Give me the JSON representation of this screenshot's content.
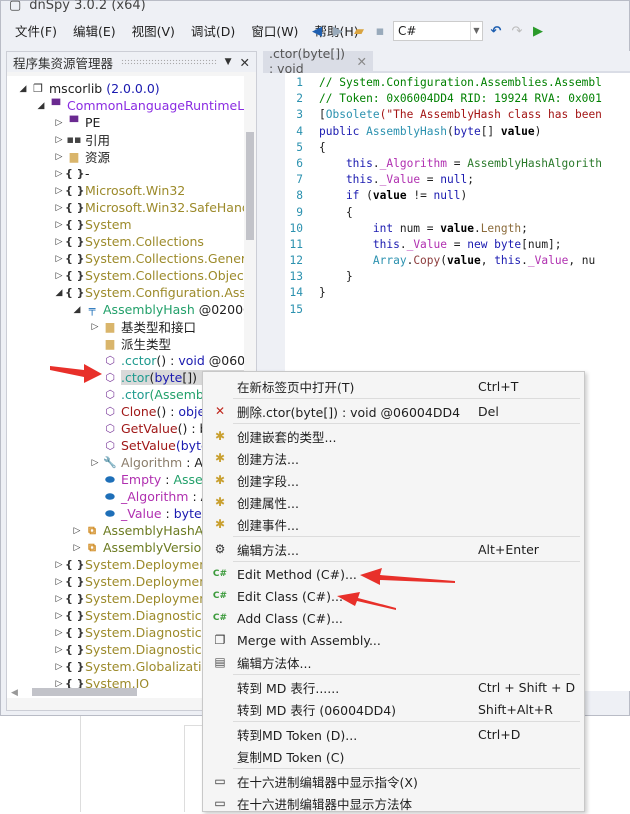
{
  "window": {
    "title": "dnSpy 3.0.2 (x64)"
  },
  "menubar": [
    "文件(F)",
    "编辑(E)",
    "视图(V)",
    "调试(D)",
    "窗口(W)",
    "帮助(H)"
  ],
  "toolbar": {
    "language": "C#",
    "icons": [
      "back-icon",
      "forward-icon",
      "open-icon",
      "save-icon",
      "undo-icon",
      "redo-icon",
      "start-icon"
    ]
  },
  "assembly_explorer": {
    "title": "程序集资源管理器",
    "items": [
      {
        "l": 0,
        "e": "open",
        "i": "assembly-icon",
        "s": [
          [
            "mscorlib ",
            "#1e1e1e"
          ],
          [
            "(2.0.0.0)",
            "#1a1ab0"
          ]
        ]
      },
      {
        "l": 1,
        "e": "open",
        "i": "module-icon",
        "s": [
          [
            "CommonLanguageRuntimeLib",
            "#8a2be2"
          ]
        ]
      },
      {
        "l": 2,
        "e": "closed",
        "i": "pe-icon",
        "s": [
          [
            "PE",
            "#1e1e1e"
          ]
        ]
      },
      {
        "l": 2,
        "e": "closed",
        "i": "references-icon",
        "s": [
          [
            "引用",
            "#1e1e1e"
          ]
        ]
      },
      {
        "l": 2,
        "e": "closed",
        "i": "folder-icon",
        "s": [
          [
            "资源",
            "#1e1e1e"
          ]
        ]
      },
      {
        "l": 2,
        "e": "closed",
        "i": "namespace-icon",
        "s": [
          [
            "-",
            "#1e1e1e"
          ]
        ]
      },
      {
        "l": 2,
        "e": "closed",
        "i": "namespace-icon",
        "s": [
          [
            "Microsoft.Win32",
            "#9c8a2a"
          ]
        ]
      },
      {
        "l": 2,
        "e": "closed",
        "i": "namespace-icon",
        "s": [
          [
            "Microsoft.Win32.SafeHand",
            "#9c8a2a"
          ]
        ]
      },
      {
        "l": 2,
        "e": "closed",
        "i": "namespace-icon",
        "s": [
          [
            "System",
            "#9c8a2a"
          ]
        ]
      },
      {
        "l": 2,
        "e": "closed",
        "i": "namespace-icon",
        "s": [
          [
            "System.Collections",
            "#9c8a2a"
          ]
        ]
      },
      {
        "l": 2,
        "e": "closed",
        "i": "namespace-icon",
        "s": [
          [
            "System.Collections.Generic",
            "#9c8a2a"
          ]
        ]
      },
      {
        "l": 2,
        "e": "closed",
        "i": "namespace-icon",
        "s": [
          [
            "System.Collections.ObjectM",
            "#9c8a2a"
          ]
        ]
      },
      {
        "l": 2,
        "e": "open",
        "i": "namespace-icon",
        "s": [
          [
            "System.Configuration.Asse",
            "#9c8a2a"
          ]
        ]
      },
      {
        "l": 3,
        "e": "open",
        "i": "class-icon",
        "s": [
          [
            "AssemblyHash ",
            "#22a06a"
          ],
          [
            "@02000",
            "#1e1e1e"
          ]
        ]
      },
      {
        "l": 4,
        "e": "closed",
        "i": "folder-icon",
        "s": [
          [
            "基类型和接口",
            "#1e1e1e"
          ]
        ]
      },
      {
        "l": 4,
        "e": "",
        "i": "folder-icon",
        "s": [
          [
            "派生类型",
            "#1e1e1e"
          ]
        ]
      },
      {
        "l": 4,
        "e": "",
        "i": "method-icon",
        "s": [
          [
            ".cctor",
            "#1e9a8e"
          ],
          [
            "() : ",
            "#1e1e1e"
          ],
          [
            "void ",
            "#1a1ab0"
          ],
          [
            "@0600",
            "#1e1e1e"
          ]
        ]
      },
      {
        "l": 4,
        "e": "",
        "i": "method-icon",
        "sel": true,
        "s": [
          [
            ".ctor",
            "#1e9a8e"
          ],
          [
            "(",
            "#1e1e1e"
          ],
          [
            "byte",
            "#1a1ab0"
          ],
          [
            "[]) : ",
            "#1e1e1e"
          ],
          [
            "void @",
            "#1a1ab0"
          ]
        ]
      },
      {
        "l": 4,
        "e": "",
        "i": "method-icon",
        "s": [
          [
            ".ctor",
            "#1e9a8e"
          ],
          [
            "(Assemb",
            "#22a06a"
          ]
        ]
      },
      {
        "l": 4,
        "e": "",
        "i": "method-icon",
        "s": [
          [
            "Clone",
            "#a01818"
          ],
          [
            "() : ",
            "#1e1e1e"
          ],
          [
            "obje",
            "#1a1ab0"
          ]
        ]
      },
      {
        "l": 4,
        "e": "",
        "i": "method-icon",
        "s": [
          [
            "GetValue",
            "#a01818"
          ],
          [
            "() : b",
            "#1e1e1e"
          ]
        ]
      },
      {
        "l": 4,
        "e": "",
        "i": "method-icon",
        "s": [
          [
            "SetValue",
            "#a01818"
          ],
          [
            "(byte",
            "#1a1ab0"
          ]
        ]
      },
      {
        "l": 4,
        "e": "closed",
        "i": "property-icon",
        "s": [
          [
            "Algorithm",
            "#8b7d6b"
          ],
          [
            " : A",
            "#1e1e1e"
          ]
        ]
      },
      {
        "l": 4,
        "e": "",
        "i": "field-icon",
        "s": [
          [
            "Empty",
            "#b030b0"
          ],
          [
            " : ",
            "#1e1e1e"
          ],
          [
            "Asse",
            "#22a06a"
          ]
        ]
      },
      {
        "l": 4,
        "e": "",
        "i": "field-icon",
        "s": [
          [
            "_Algorithm",
            "#b030b0"
          ],
          [
            " : A",
            "#1e1e1e"
          ]
        ]
      },
      {
        "l": 4,
        "e": "",
        "i": "field-icon",
        "s": [
          [
            "_Value",
            "#b030b0"
          ],
          [
            " : ",
            "#1e1e1e"
          ],
          [
            "byte[",
            "#1a1ab0"
          ]
        ]
      },
      {
        "l": 3,
        "e": "closed",
        "i": "enum-icon",
        "s": [
          [
            "AssemblyHashAl",
            "#6b7a20"
          ]
        ]
      },
      {
        "l": 3,
        "e": "closed",
        "i": "enum-icon",
        "s": [
          [
            "AssemblyVersion",
            "#6b7a20"
          ]
        ]
      },
      {
        "l": 2,
        "e": "closed",
        "i": "namespace-icon",
        "s": [
          [
            "System.Deployment",
            "#9c8a2a"
          ]
        ]
      },
      {
        "l": 2,
        "e": "closed",
        "i": "namespace-icon",
        "s": [
          [
            "System.Deployment",
            "#9c8a2a"
          ]
        ]
      },
      {
        "l": 2,
        "e": "closed",
        "i": "namespace-icon",
        "s": [
          [
            "System.Deployment",
            "#9c8a2a"
          ]
        ]
      },
      {
        "l": 2,
        "e": "closed",
        "i": "namespace-icon",
        "s": [
          [
            "System.Diagnostics",
            "#9c8a2a"
          ]
        ]
      },
      {
        "l": 2,
        "e": "closed",
        "i": "namespace-icon",
        "s": [
          [
            "System.Diagnostics.",
            "#9c8a2a"
          ]
        ]
      },
      {
        "l": 2,
        "e": "closed",
        "i": "namespace-icon",
        "s": [
          [
            "System.Diagnostics.",
            "#9c8a2a"
          ]
        ]
      },
      {
        "l": 2,
        "e": "closed",
        "i": "namespace-icon",
        "s": [
          [
            "System.Globalizatio",
            "#9c8a2a"
          ]
        ]
      },
      {
        "l": 2,
        "e": "closed",
        "i": "namespace-icon",
        "s": [
          [
            "System.IO",
            "#9c8a2a"
          ]
        ]
      }
    ]
  },
  "editor": {
    "tab": ".ctor(byte[]) : void",
    "lines": [
      [
        [
          "// System.Configuration.Assemblies.Assembl",
          "#008000"
        ]
      ],
      [
        [
          "// Token: 0x06004DD4 RID: 19924 RVA: 0x001",
          "#008000"
        ]
      ],
      [
        [
          "[",
          "#1e1e1e"
        ],
        [
          "Obsolete",
          "#2b91af"
        ],
        [
          "(\"The AssemblyHash class has been",
          "#a31515"
        ]
      ],
      [
        [
          "public ",
          "#1a1ab0"
        ],
        [
          "AssemblyHash",
          "#2b91af"
        ],
        [
          "(",
          "#1e1e1e"
        ],
        [
          "byte",
          "#1a1ab0"
        ],
        [
          "[] ",
          "#1e1e1e"
        ],
        [
          "value",
          "#000",
          "b"
        ],
        [
          ")",
          "#1e1e1e"
        ]
      ],
      [
        [
          "{",
          "#1e1e1e"
        ]
      ],
      [
        [
          "    this",
          "#1a1ab0"
        ],
        [
          ".",
          "#1e1e1e"
        ],
        [
          "_Algorithm",
          "#b030b0"
        ],
        [
          " = ",
          "#1e1e1e"
        ],
        [
          "AssemblyHashAlgorith",
          "#2b7a2b"
        ]
      ],
      [
        [
          "    this",
          "#1a1ab0"
        ],
        [
          ".",
          "#1e1e1e"
        ],
        [
          "_Value",
          "#b030b0"
        ],
        [
          " = ",
          "#1e1e1e"
        ],
        [
          "null",
          "#1a1ab0"
        ],
        [
          ";",
          "#1e1e1e"
        ]
      ],
      [
        [
          "    if",
          "#1a1ab0"
        ],
        [
          " (",
          "#1e1e1e"
        ],
        [
          "value",
          "#000",
          "b"
        ],
        [
          " != ",
          "#1e1e1e"
        ],
        [
          "null",
          "#1a1ab0"
        ],
        [
          ")",
          "#1e1e1e"
        ]
      ],
      [
        [
          "    {",
          "#1e1e1e"
        ]
      ],
      [
        [
          "        int",
          "#1a1ab0"
        ],
        [
          " num = ",
          "#1e1e1e"
        ],
        [
          "value",
          "#000",
          "b"
        ],
        [
          ".",
          "#1e1e1e"
        ],
        [
          "Length",
          "#8b6b3b"
        ],
        [
          ";",
          "#1e1e1e"
        ]
      ],
      [
        [
          "        this",
          "#1a1ab0"
        ],
        [
          ".",
          "#1e1e1e"
        ],
        [
          "_Value",
          "#b030b0"
        ],
        [
          " = ",
          "#1e1e1e"
        ],
        [
          "new byte",
          "#1a1ab0"
        ],
        [
          "[num];",
          "#1e1e1e"
        ]
      ],
      [
        [
          "        Array",
          "#2b91af"
        ],
        [
          ".",
          "#1e1e1e"
        ],
        [
          "Copy",
          "#8b3b3b"
        ],
        [
          "(",
          "#1e1e1e"
        ],
        [
          "value",
          "#000",
          "b"
        ],
        [
          ", ",
          "#1e1e1e"
        ],
        [
          "this",
          "#1a1ab0"
        ],
        [
          ".",
          "#1e1e1e"
        ],
        [
          "_Value",
          "#b030b0"
        ],
        [
          ", nu",
          "#1e1e1e"
        ]
      ],
      [
        [
          "    }",
          "#1e1e1e"
        ]
      ],
      [
        [
          "}",
          "#1e1e1e"
        ]
      ],
      [
        [
          "",
          ""
        ]
      ]
    ]
  },
  "context_menu": {
    "items": [
      {
        "label": "在新标签页中打开(T)",
        "key": "Ctrl+T",
        "icon": ""
      },
      {
        "sep": true
      },
      {
        "label": "删除.ctor(byte[]) : void @06004DD4",
        "key": "Del",
        "icon": "delete-icon"
      },
      {
        "sep": true
      },
      {
        "label": "创建嵌套的类型...",
        "key": "",
        "icon": "create-nested-type-icon"
      },
      {
        "label": "创建方法...",
        "key": "",
        "icon": "create-method-icon"
      },
      {
        "label": "创建字段...",
        "key": "",
        "icon": "create-field-icon"
      },
      {
        "label": "创建属性...",
        "key": "",
        "icon": "create-property-icon"
      },
      {
        "label": "创建事件...",
        "key": "",
        "icon": "create-event-icon"
      },
      {
        "sep": true
      },
      {
        "label": "编辑方法...",
        "key": "Alt+Enter",
        "icon": "gear-icon"
      },
      {
        "sep": true
      },
      {
        "label": "Edit Method (C#)...",
        "key": "",
        "icon": "csharp-icon"
      },
      {
        "label": "Edit Class (C#)...",
        "key": "",
        "icon": "csharp-icon"
      },
      {
        "label": "Add Class (C#)...",
        "key": "",
        "icon": "csharp-icon"
      },
      {
        "label": "Merge with Assembly...",
        "key": "",
        "icon": "merge-icon"
      },
      {
        "label": "编辑方法体...",
        "key": "",
        "icon": "method-body-icon"
      },
      {
        "sep": true
      },
      {
        "label": "转到 MD 表行......",
        "key": "Ctrl + Shift + D",
        "icon": ""
      },
      {
        "label": "转到 MD 表行 (06004DD4)",
        "key": "Shift+Alt+R",
        "icon": ""
      },
      {
        "sep": true
      },
      {
        "label": "转到MD Token (D)...",
        "key": "Ctrl+D",
        "icon": ""
      },
      {
        "label": "复制MD Token (C)",
        "key": "",
        "icon": ""
      },
      {
        "sep": true
      },
      {
        "label": "在十六进制编辑器中显示指令(X)",
        "key": "",
        "icon": "hex-icon"
      },
      {
        "label": "在十六进制编辑器中显示方法体",
        "key": "",
        "icon": "hex-icon"
      }
    ]
  },
  "colors": {
    "annotation_arrow": "#e8302a",
    "selection": "#d9d9d9"
  }
}
